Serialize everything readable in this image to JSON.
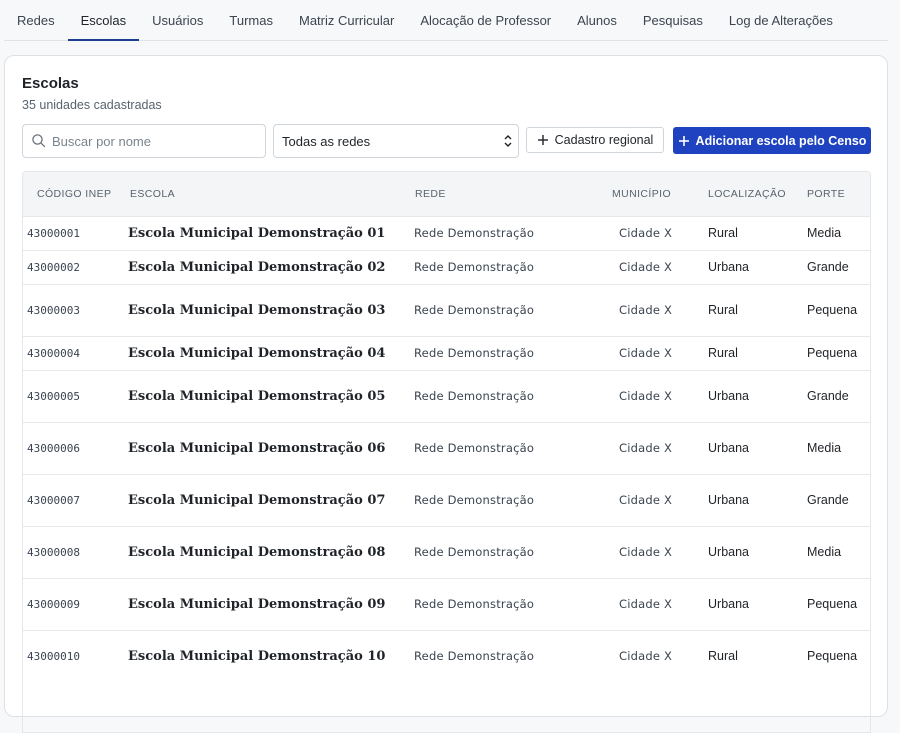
{
  "tabs": [
    {
      "label": "Redes",
      "active": false
    },
    {
      "label": "Escolas",
      "active": true
    },
    {
      "label": "Usuários",
      "active": false
    },
    {
      "label": "Turmas",
      "active": false
    },
    {
      "label": "Matriz Curricular",
      "active": false
    },
    {
      "label": "Alocação de Professor",
      "active": false
    },
    {
      "label": "Alunos",
      "active": false
    },
    {
      "label": "Pesquisas",
      "active": false
    },
    {
      "label": "Log de Alterações",
      "active": false
    }
  ],
  "card": {
    "title": "Escolas",
    "subtitle": "35 unidades cadastradas"
  },
  "toolbar": {
    "search_placeholder": "Buscar por nome",
    "search_value": "",
    "network_select_value": "Todas as redes",
    "regional_button_label": "Cadastro regional",
    "add_button_label": "Adicionar escola pelo Censo"
  },
  "colors": {
    "accent": "#1f43c0",
    "active_tab_underline": "#1f3d8f"
  },
  "icons": {
    "search": "search-icon",
    "select": "chevron-up-down-icon",
    "add": "plus-icon"
  },
  "table": {
    "headers": [
      "CÓDIGO INEP",
      "ESCOLA",
      "REDE",
      "MUNICÍPIO",
      "LOCALIZAÇÃO",
      "PORTE"
    ],
    "rows": [
      {
        "code": "43000001",
        "name": "Escola Municipal Demonstração 01",
        "rede": "Rede Demonstração",
        "municipio": "Cidade X",
        "localizacao": "Rural",
        "porte": "Media"
      },
      {
        "code": "43000002",
        "name": "Escola Municipal Demonstração 02",
        "rede": "Rede Demonstração",
        "municipio": "Cidade X",
        "localizacao": "Urbana",
        "porte": "Grande"
      },
      {
        "code": "43000003",
        "name": "Escola Municipal Demonstração 03",
        "rede": "Rede Demonstração",
        "municipio": "Cidade X",
        "localizacao": "Rural",
        "porte": "Pequena"
      },
      {
        "code": "43000004",
        "name": "Escola Municipal Demonstração 04",
        "rede": "Rede Demonstração",
        "municipio": "Cidade X",
        "localizacao": "Rural",
        "porte": "Pequena"
      },
      {
        "code": "43000005",
        "name": "Escola Municipal Demonstração 05",
        "rede": "Rede Demonstração",
        "municipio": "Cidade X",
        "localizacao": "Urbana",
        "porte": "Grande"
      },
      {
        "code": "43000006",
        "name": "Escola Municipal Demonstração 06",
        "rede": "Rede Demonstração",
        "municipio": "Cidade X",
        "localizacao": "Urbana",
        "porte": "Media"
      },
      {
        "code": "43000007",
        "name": "Escola Municipal Demonstração 07",
        "rede": "Rede Demonstração",
        "municipio": "Cidade X",
        "localizacao": "Urbana",
        "porte": "Grande"
      },
      {
        "code": "43000008",
        "name": "Escola Municipal Demonstração 08",
        "rede": "Rede Demonstração",
        "municipio": "Cidade X",
        "localizacao": "Urbana",
        "porte": "Media"
      },
      {
        "code": "43000009",
        "name": "Escola Municipal Demonstração 09",
        "rede": "Rede Demonstração",
        "municipio": "Cidade X",
        "localizacao": "Urbana",
        "porte": "Pequena"
      },
      {
        "code": "43000010",
        "name": "Escola Municipal Demonstração 10",
        "rede": "Rede Demonstração",
        "municipio": "Cidade X",
        "localizacao": "Rural",
        "porte": "Pequena"
      }
    ]
  }
}
